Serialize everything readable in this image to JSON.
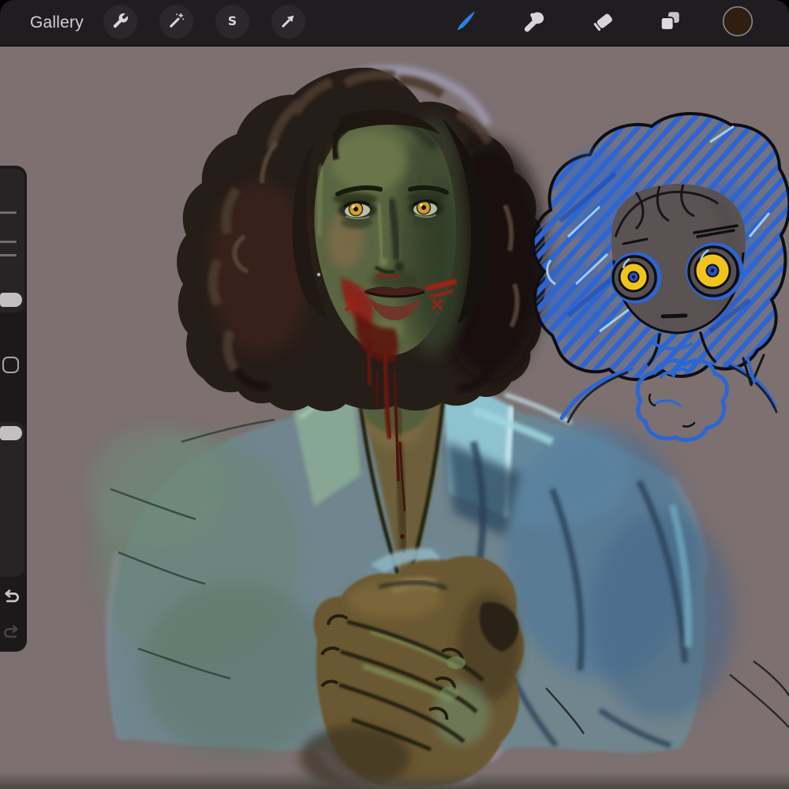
{
  "top_bar": {
    "background": "#201d20",
    "gallery_label": "Gallery",
    "left_tools": [
      {
        "id": "actions",
        "icon": "wrench-icon"
      },
      {
        "id": "adjustments",
        "icon": "magic-wand-icon"
      },
      {
        "id": "selection",
        "icon": "selection-s-icon",
        "glyph": "S"
      },
      {
        "id": "transform",
        "icon": "transform-arrow-icon"
      }
    ],
    "right_tools": [
      {
        "id": "paint",
        "icon": "paint-brush-icon",
        "selected": true,
        "accent_color": "#2e7ce4"
      },
      {
        "id": "smudge",
        "icon": "smudge-finger-icon",
        "selected": false
      },
      {
        "id": "erase",
        "icon": "eraser-icon",
        "selected": false
      },
      {
        "id": "layers",
        "icon": "layers-icon",
        "selected": false
      },
      {
        "id": "color",
        "icon": "color-swatch",
        "swatch_color": "#301f11"
      }
    ]
  },
  "sidebar": {
    "size_slider": {
      "ticks": 3,
      "handle": "near-bottom"
    },
    "modify_button": {
      "present": true
    },
    "opacity_slider": {
      "ticks": 0,
      "handle": "near-top"
    },
    "undo": {
      "enabled": true
    },
    "redo": {
      "enabled": false
    }
  },
  "canvas": {
    "background_color": "#7c7071",
    "artwork": {
      "description": "Digital painting: pale olive-skinned figure with dark curly shoulder-length hair, glowing amber eyes and blood smeared around the mouth and chin, wearing a loose light-blue shirt with hands clasped below; at top right a blue-pencil chibi sketch of the same character with big yellow eyes and clasped hands.",
      "palette": {
        "skin_olive": "#5a6542",
        "hair_dark": "#251d18",
        "shirt_blue": "#5b8fae",
        "shirt_sage": "#64806f",
        "collar_highlight": "#9fd8df",
        "blood_red": "#8e1d12",
        "eye_amber": "#d3a02c",
        "sketch_blue": "#2b66d6",
        "sketch_yellow": "#f0c41c",
        "halo_lavender": "#aca9c9"
      }
    }
  }
}
